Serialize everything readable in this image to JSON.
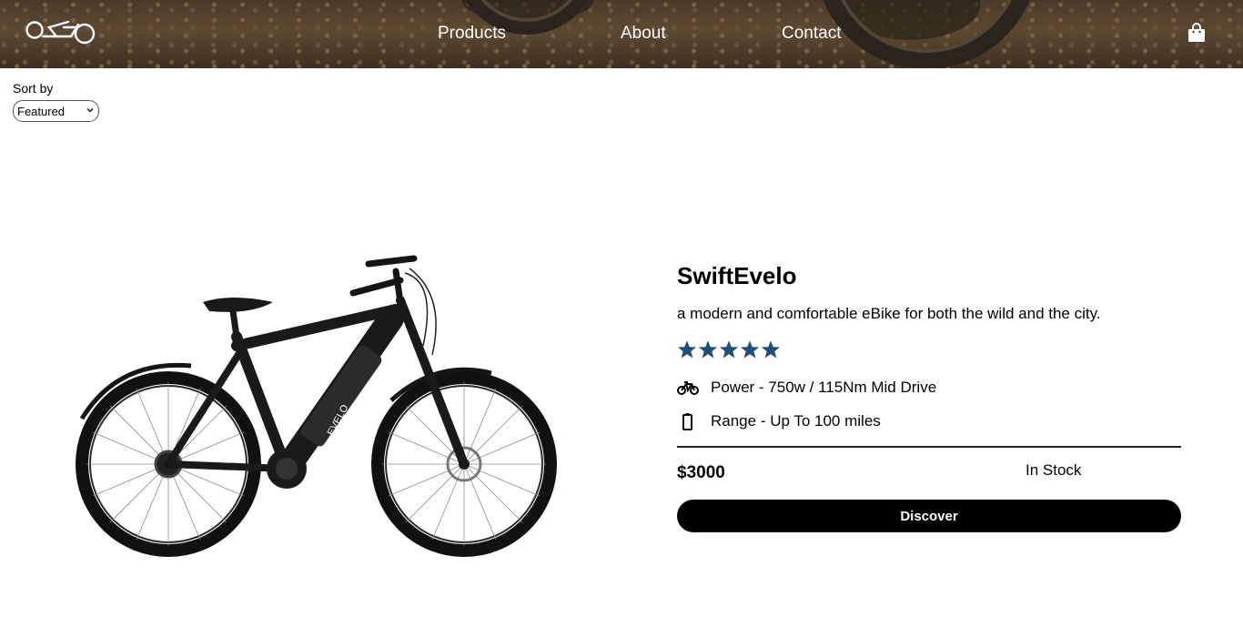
{
  "header": {
    "logo_icon": "osso-bike-logo",
    "nav": [
      {
        "label": "Products"
      },
      {
        "label": "About"
      },
      {
        "label": "Contact"
      }
    ],
    "cart_icon": "shopping-bag-icon"
  },
  "sort": {
    "label": "Sort by",
    "selected": "Featured"
  },
  "product": {
    "name": "SwiftEvelo",
    "description": "a modern and comfortable eBike for both the wild and the city.",
    "rating": 5,
    "rating_max": 5,
    "star_color": "#1f4e79",
    "specs": [
      {
        "icon": "bicycle-icon",
        "text": "Power - 750w / 115Nm Mid Drive"
      },
      {
        "icon": "battery-icon",
        "text": "Range - Up To 100 miles"
      }
    ],
    "price": "$3000",
    "stock": "In Stock",
    "cta": "Discover",
    "frame_brand": "EVELO"
  }
}
